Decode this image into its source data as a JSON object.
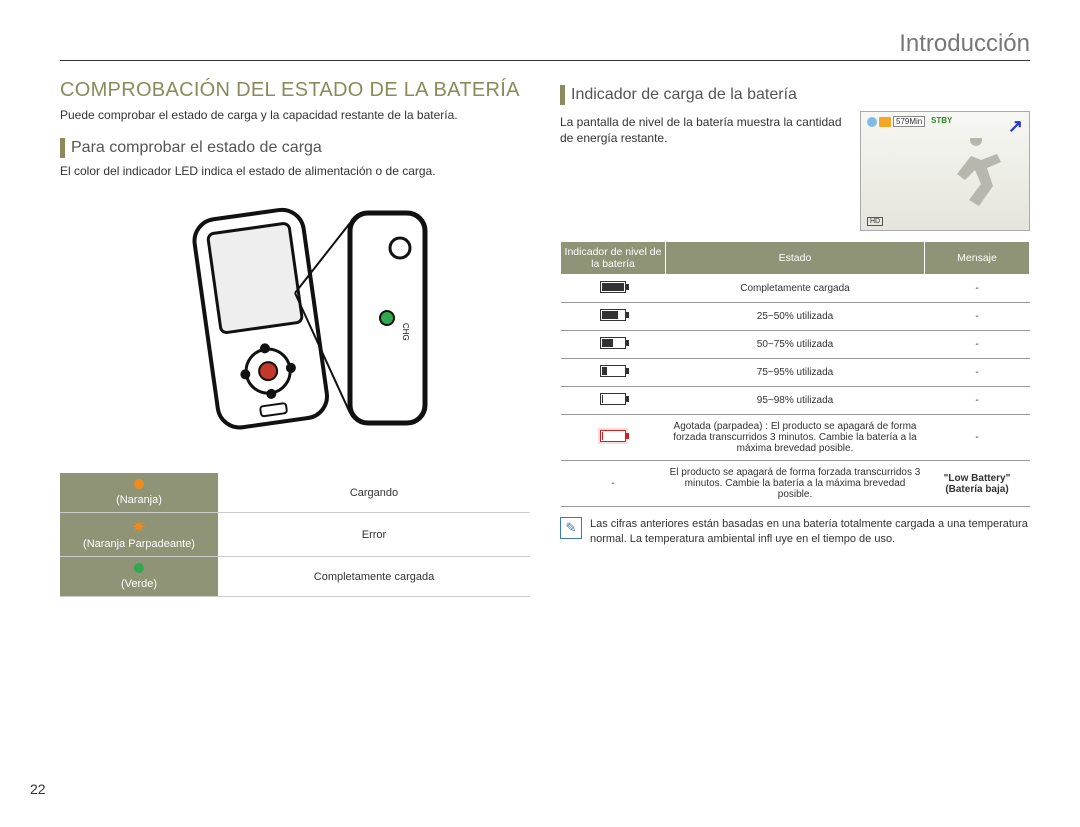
{
  "header": {
    "title": "Introducción"
  },
  "page_number": "22",
  "left": {
    "heading": "COMPROBACIÓN DEL ESTADO DE LA BATERÍA",
    "intro": "Puede comprobar el estado de carga y la capacidad restante de la batería.",
    "sub_heading": "Para comprobar el estado de carga",
    "sub_text": "El color del indicador LED indica el estado de alimentación o de carga.",
    "led_table": [
      {
        "label": "(Naranja)",
        "icon": "orange",
        "status": "Cargando"
      },
      {
        "label": "(Naranja Parpadeante)",
        "icon": "orange-blink",
        "status": "Error"
      },
      {
        "label": "(Verde)",
        "icon": "green",
        "status": "Completamente cargada"
      }
    ]
  },
  "right": {
    "sub_heading": "Indicador de carga de la batería",
    "sub_text": "La pantalla de nivel de la batería muestra la cantidad de energía restante.",
    "screen": {
      "min": "579Min",
      "stby": "STBY",
      "hd": "HD"
    },
    "table_headers": {
      "col1": "Indicador de nivel de la batería",
      "col2": "Estado",
      "col3": "Mensaje"
    },
    "rows": [
      {
        "level": "full",
        "status": "Completamente cargada",
        "msg": "-"
      },
      {
        "level": "b3",
        "status": "25~50% utilizada",
        "msg": "-"
      },
      {
        "level": "b2",
        "status": "50~75% utilizada",
        "msg": "-"
      },
      {
        "level": "b1",
        "status": "75~95% utilizada",
        "msg": "-"
      },
      {
        "level": "b0",
        "status": "95~98% utilizada",
        "msg": "-"
      },
      {
        "level": "red",
        "status": "Agotada (parpadea) : El producto se apagará de forma forzada transcurridos 3 minutos. Cambie la batería a la máxima brevedad posible.",
        "msg": "-"
      },
      {
        "level": "none",
        "status": "El producto se apagará de forma forzada transcurridos 3 minutos. Cambie la batería a la máxima brevedad posible.",
        "msg": "\"Low Battery\" (Batería baja)"
      }
    ],
    "note": "Las cifras anteriores están basadas en una batería totalmente cargada a una temperatura normal. La temperatura ambiental infl uye en el tiempo de uso."
  }
}
